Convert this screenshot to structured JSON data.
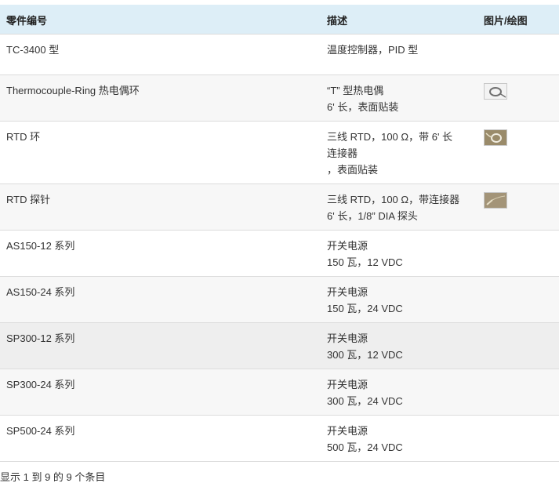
{
  "headers": {
    "part_no": "零件编号",
    "description": "描述",
    "image": "图片/绘图"
  },
  "rows": [
    {
      "part": "TC-3400 型",
      "desc": [
        "温度控制器，PID 型"
      ],
      "image": ""
    },
    {
      "part": "Thermocouple-Ring 热电偶环",
      "desc": [
        "“T” 型热电偶",
        "6' 长，表面贴装"
      ],
      "image": "thermocouple-ring-photo"
    },
    {
      "part": "RTD 环",
      "desc": [
        "三线 RTD，100 Ω，带 6' 长",
        "连接器",
        "，表面贴装"
      ],
      "image": "rtd-ring-photo"
    },
    {
      "part": "RTD 探针",
      "desc": [
        "三线 RTD，100 Ω，带连接器",
        "6' 长，1/8” DIA 探头"
      ],
      "image": "rtd-probe-photo"
    },
    {
      "part": "AS150-12 系列",
      "desc": [
        "开关电源",
        "150 瓦，12 VDC"
      ],
      "image": ""
    },
    {
      "part": "AS150-24 系列",
      "desc": [
        "开关电源",
        "150 瓦，24 VDC"
      ],
      "image": ""
    },
    {
      "part": "SP300-12 系列",
      "desc": [
        "开关电源",
        "300 瓦，12 VDC"
      ],
      "image": ""
    },
    {
      "part": "SP300-24 系列",
      "desc": [
        "开关电源",
        "300 瓦，24 VDC"
      ],
      "image": ""
    },
    {
      "part": "SP500-24 系列",
      "desc": [
        "开关电源",
        "500 瓦，24 VDC"
      ],
      "image": ""
    }
  ],
  "footer": {
    "info": "显示 1 到 9 的 9 个条目"
  },
  "colors": {
    "header_bg": "#ddeef7",
    "row_alt_bg": "#f7f7f7",
    "row_hover_bg": "#eeeeee",
    "border": "#dcdcdc"
  }
}
